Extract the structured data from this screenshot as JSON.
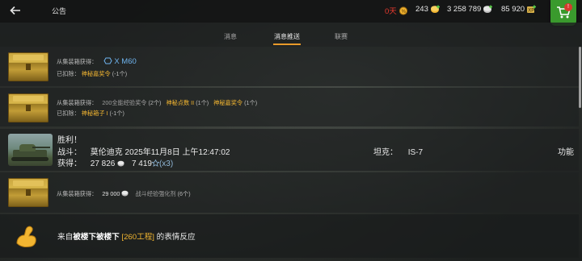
{
  "header": {
    "back_icon": "arrow-left-icon",
    "title": "公告",
    "currencies": [
      {
        "value": "0天",
        "icon": "premium-icon",
        "color": "#e83a2e"
      },
      {
        "value": "243",
        "icon": "gold-coin-plus-icon",
        "color": "#f2b531"
      },
      {
        "value": "3 258 789",
        "icon": "silver-coin-plus-icon",
        "color": "#dadada"
      },
      {
        "value": "85 920",
        "icon": "free-xp-plus-icon",
        "color": "#e8c060"
      }
    ],
    "shop_badge": "!"
  },
  "tabs": [
    {
      "label": "消息",
      "active": false
    },
    {
      "label": "消息推送",
      "active": true
    },
    {
      "label": "联赛",
      "active": false
    }
  ],
  "messages": [
    {
      "line1_prefix": "从集装箱获得：",
      "line1_item": "X M60",
      "line2_prefix": "已扣除：",
      "line2_item": "神秘嘉奖令",
      "line2_count": "(-1个)"
    },
    {
      "line1_prefix": "从集装箱获得：",
      "line1_item_a": "200全能经验奖令",
      "line1_count_a": "(2个)",
      "line1_item_b": "神秘点数 II",
      "line1_count_b": "(1个)",
      "line1_item_c": "神秘嘉奖令",
      "line1_count_c": "(1个)",
      "line2_prefix": "已扣除：",
      "line2_item": "神秘箱子 I",
      "line2_count": "(-1个)"
    },
    {
      "result": "胜利！",
      "battle_label": "战斗：",
      "battle_value": "莫伦迪克 2025年11月8日 上午12:47:02",
      "earned_label": "获得：",
      "credits": "27 826",
      "xp": "7 419",
      "xp_mult": "(x3)",
      "tank_label": "坦克：",
      "tank_value": "IS-7",
      "function_label": "功能"
    },
    {
      "line1_prefix": "从集装箱获得：",
      "credits": "29 000",
      "item": "战斗经验强化剂",
      "count": "(6个)"
    },
    {
      "prefix": "来自",
      "player": "被楼下被楼下",
      "clan": "[260工程]",
      "suffix": "的表情反应"
    }
  ],
  "colors": {
    "accent": "#e89a2a",
    "gold": "#f2b531",
    "blue": "#6fb4ef",
    "shop": "#3a9a2d"
  }
}
